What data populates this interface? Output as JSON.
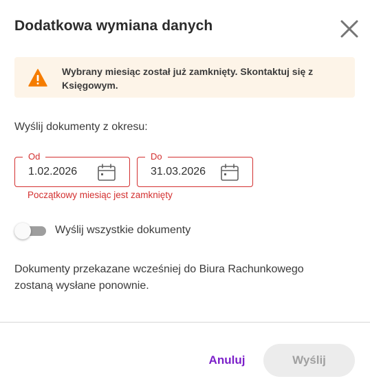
{
  "dialog": {
    "title": "Dodatkowa wymiana danych",
    "close_icon": "close-icon"
  },
  "alert": {
    "icon": "warning-icon",
    "message": "Wybrany miesiąc został już zamknięty. Skontaktuj się z Księgowym.",
    "background_color": "#fdf4e8",
    "icon_color": "#f57c00"
  },
  "period": {
    "label": "Wyślij dokumenty z okresu:",
    "from": {
      "legend": "Od",
      "value": "1.02.2026",
      "icon": "calendar-icon"
    },
    "to": {
      "legend": "Do",
      "value": "31.03.2026",
      "icon": "calendar-icon"
    },
    "error": "Początkowy miesiąc jest zamknięty",
    "error_color": "#d32f2f"
  },
  "send_all": {
    "label": "Wyślij wszystkie dokumenty",
    "checked": false
  },
  "info": "Dokumenty przekazane wcześniej do Biura Rachunkowego zostaną wysłane ponownie.",
  "actions": {
    "cancel_label": "Anuluj",
    "send_label": "Wyślij",
    "send_disabled": true,
    "accent_color": "#7b1fc9"
  }
}
